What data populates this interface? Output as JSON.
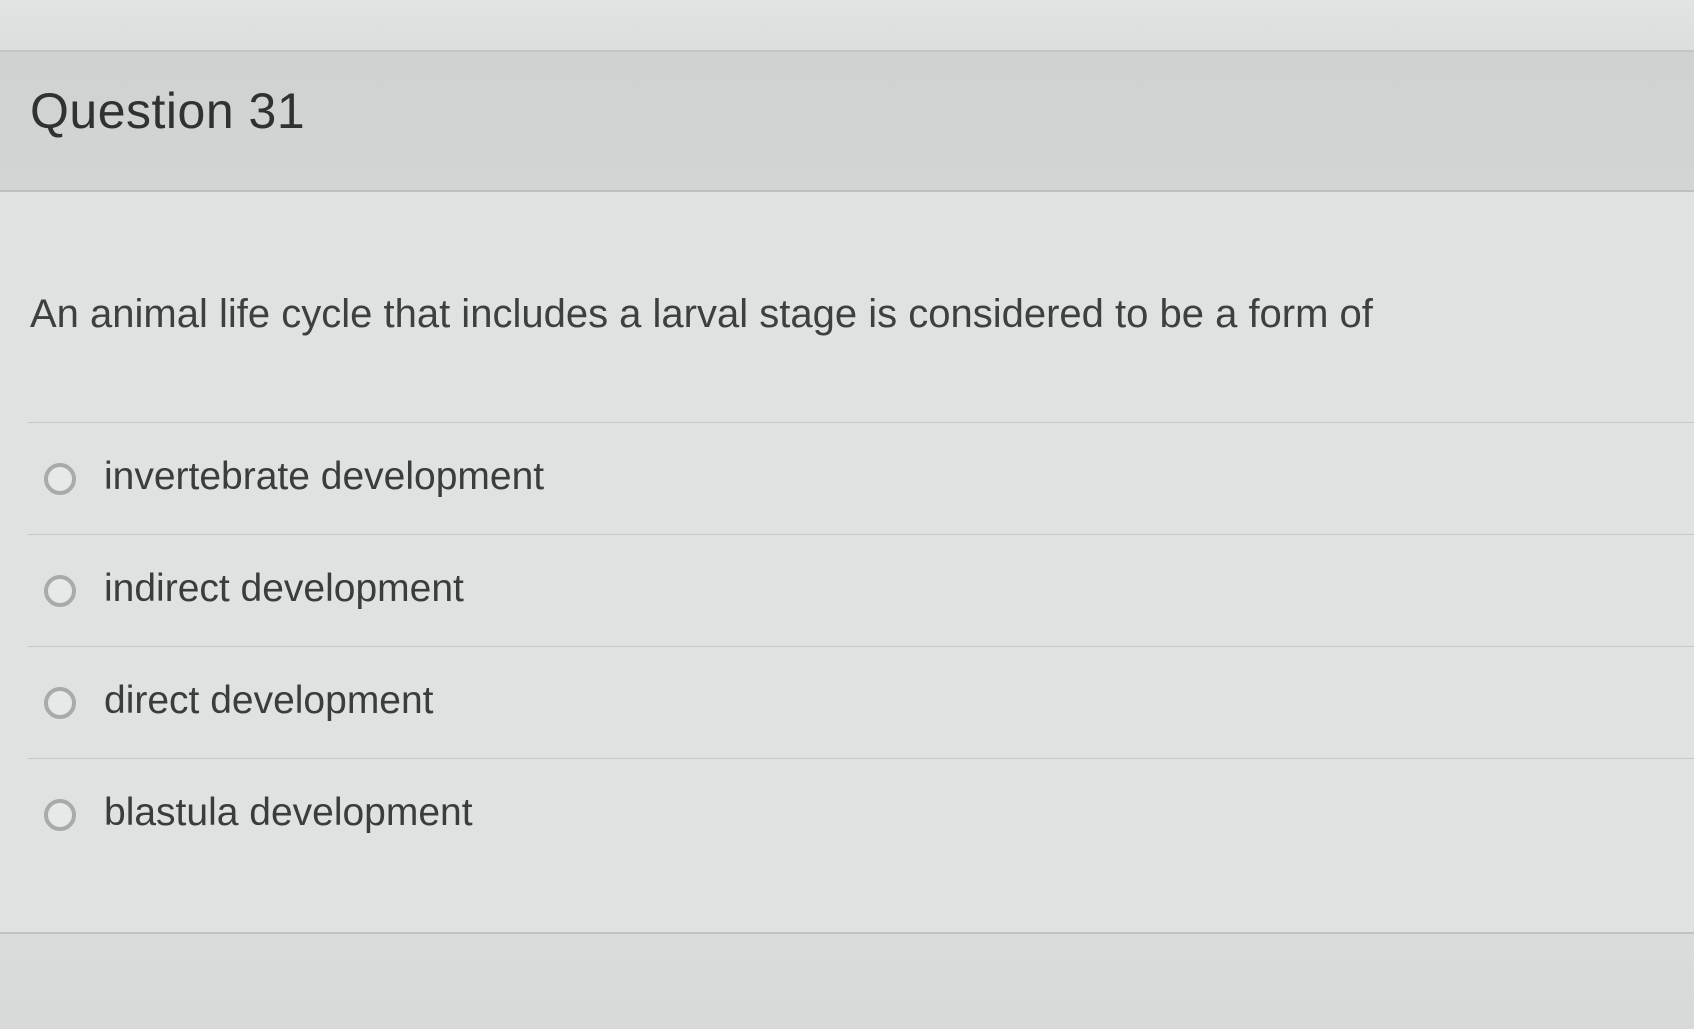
{
  "question": {
    "title": "Question 31",
    "text": "An animal life cycle that includes a larval stage is considered to be a form of"
  },
  "answers": [
    {
      "label": "invertebrate development",
      "selected": false
    },
    {
      "label": "indirect development",
      "selected": false
    },
    {
      "label": "direct development",
      "selected": false
    },
    {
      "label": "blastula development",
      "selected": false
    }
  ],
  "colors": {
    "background": "#dee2e1",
    "header_background": "#cfd2d1",
    "title_text": "#2f3231",
    "body_text": "#3c403f",
    "radio_border": "#a7abaa"
  }
}
